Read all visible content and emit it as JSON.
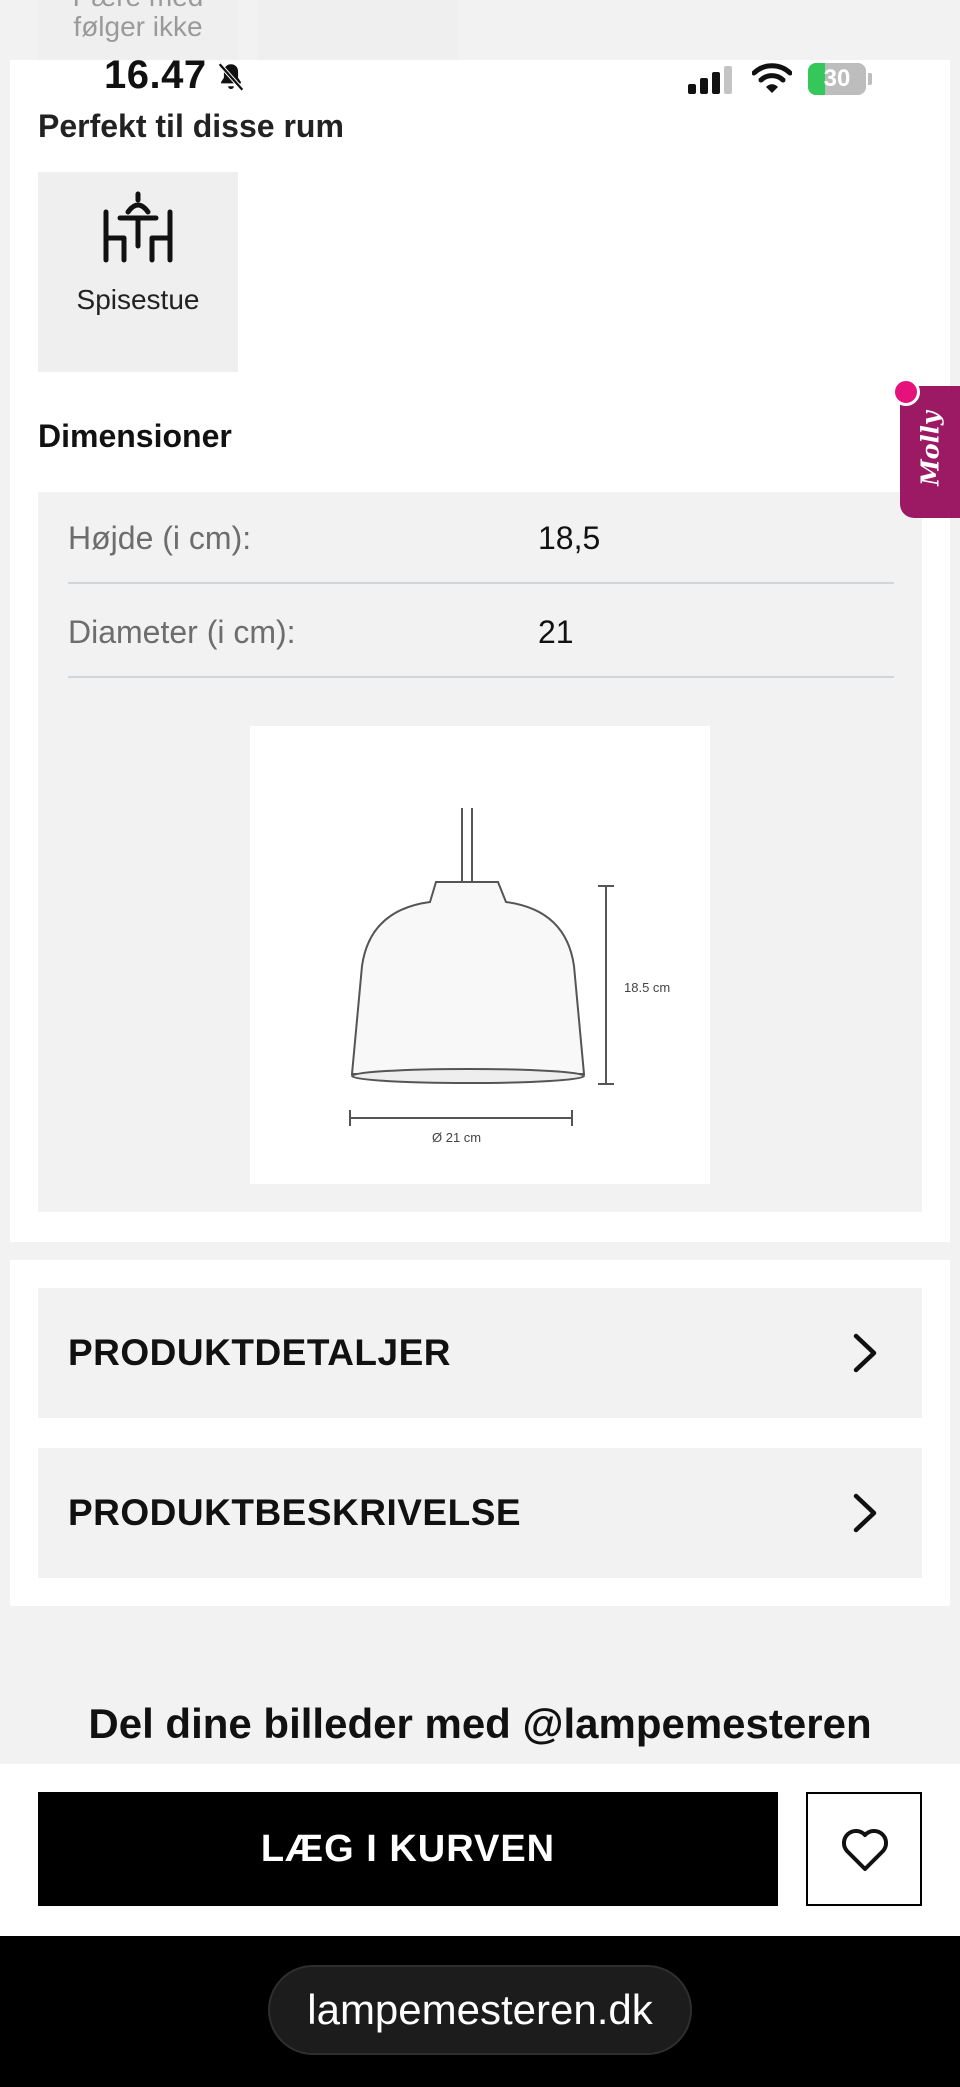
{
  "status_bar": {
    "time": "16.47",
    "battery": "30",
    "battery_level": 0.3,
    "icons": [
      "bell-slash-icon",
      "cellular-signal-icon",
      "wifi-icon",
      "battery-icon"
    ]
  },
  "top_tiles": {
    "left_text": "følger ikke",
    "left_text_partial": "Pære med"
  },
  "rooms": {
    "title": "Perfekt til disse rum",
    "items": [
      {
        "label": "Spisestue",
        "icon": "dining-room-icon"
      }
    ]
  },
  "dimensions": {
    "title": "Dimensioner",
    "rows": [
      {
        "label": "Højde (i cm):",
        "value": "18,5"
      },
      {
        "label": "Diameter (i cm):",
        "value": "21"
      }
    ],
    "diagram": {
      "height_label": "18.5 cm",
      "diameter_label": "Ø 21 cm"
    }
  },
  "accordions": [
    {
      "label": "PRODUKTDETALJER",
      "icon": "chevron-right-icon"
    },
    {
      "label": "PRODUKTBESKRIVELSE",
      "icon": "chevron-right-icon"
    }
  ],
  "share": {
    "text": "Del dine billeder med @lampemesteren"
  },
  "molly": {
    "label": "Molly",
    "color": "#9b1a63",
    "dot_color": "#e4127a"
  },
  "actions": {
    "cart_label": "LÆG I KURVEN",
    "favorite_icon": "heart-icon"
  },
  "browser": {
    "url": "lampemesteren.dk"
  }
}
